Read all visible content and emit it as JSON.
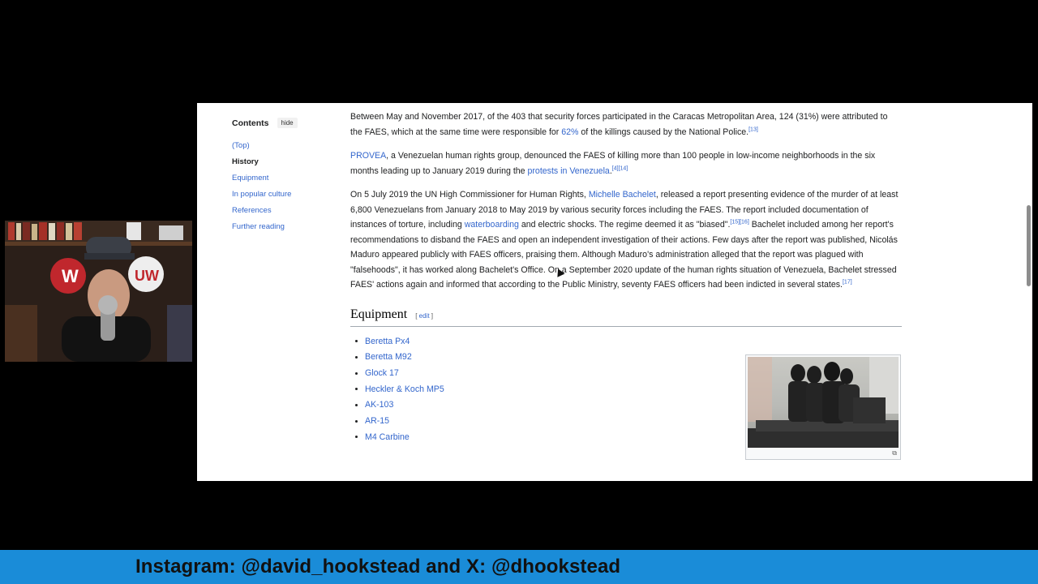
{
  "toc": {
    "title": "Contents",
    "hide_label": "hide",
    "items": [
      {
        "label": "(Top)"
      },
      {
        "label": "History"
      },
      {
        "label": "Equipment"
      },
      {
        "label": "In popular culture"
      },
      {
        "label": "References"
      },
      {
        "label": "Further reading"
      }
    ]
  },
  "article": {
    "p1": {
      "text_a": "Between May and November 2017, of the 403 that security forces participated in the Caracas Metropolitan Area, 124 (31%) were attributed to the FAES, which at the same time were responsible for ",
      "link_a": "62%",
      "text_b": " of the killings caused by the National Police.",
      "ref": "[13]"
    },
    "p2": {
      "link_a": "PROVEA",
      "text_a": ", a Venezuelan human rights group, denounced the FAES of killing more than 100 people in low-income neighborhoods in the six months leading up to January 2019 during the ",
      "link_b": "protests in Venezuela",
      "text_b": ".",
      "ref": "[4][14]"
    },
    "p3": {
      "text_a": "On 5 July 2019 the UN High Commissioner for Human Rights, ",
      "link_a": "Michelle Bachelet",
      "text_b": ", released a report presenting evidence of the murder of at least 6,800 Venezuelans from January 2018 to May 2019 by various security forces including the FAES. The report included documentation of instances of torture, including ",
      "link_b": "waterboarding",
      "text_c": " and electric shocks. The regime deemed it as \"biased\".",
      "ref_a": "[15][16]",
      "text_d": " Bachelet included among her report's recommendations to disband the FAES and open an independent investigation of their actions. Few days after the report was published, Nicolás Maduro appeared publicly with FAES officers, praising them. Although Maduro's administration alleged that the report was plagued with \"falsehoods\", it has worked along Bachelet's Office. On a September 2020 update of the human rights situation of Venezuela, Bachelet stressed FAES' actions again and informed that according to the Public Ministry, seventy FAES officers had been indicted in several states.",
      "ref_b": "[17]"
    },
    "equipment": {
      "heading": "Equipment",
      "edit_open": "[ ",
      "edit_label": "edit",
      "edit_close": " ]",
      "items": [
        {
          "label": "Beretta Px4"
        },
        {
          "label": "Beretta M92"
        },
        {
          "label": "Glock 17"
        },
        {
          "label": "Heckler & Koch MP5"
        },
        {
          "label": "AK-103"
        },
        {
          "label": "AR-15"
        },
        {
          "label": "M4 Carbine"
        }
      ]
    }
  },
  "banner": {
    "text": "Instagram: @david_hookstead and X: @dhookstead"
  },
  "colors": {
    "link": "#3366cc",
    "banner": "#1a8cd8",
    "background": "#000000"
  }
}
